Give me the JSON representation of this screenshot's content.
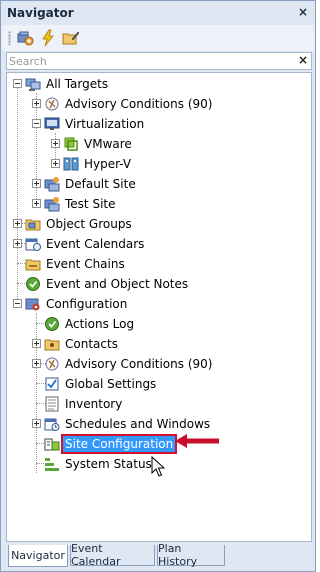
{
  "panel": {
    "title": "Navigator",
    "close_glyph": "×"
  },
  "toolbar": {
    "buttons": [
      {
        "name": "add-target-icon"
      },
      {
        "name": "lightning-icon"
      },
      {
        "name": "folder-edit-icon"
      }
    ]
  },
  "search": {
    "placeholder": "Search",
    "value": "",
    "clear_glyph": "×"
  },
  "tree": {
    "nodes": [
      {
        "label": "All Targets",
        "icon": "all-targets-icon"
      },
      {
        "label": "Advisory Conditions (90)",
        "icon": "advisory-icon"
      },
      {
        "label": "Virtualization",
        "icon": "monitor-icon"
      },
      {
        "label": "VMware",
        "icon": "vmware-icon"
      },
      {
        "label": "Hyper-V",
        "icon": "hyperv-icon"
      },
      {
        "label": "Default Site",
        "icon": "site-icon"
      },
      {
        "label": "Test Site",
        "icon": "site-icon"
      },
      {
        "label": "Object Groups",
        "icon": "object-groups-icon"
      },
      {
        "label": "Event Calendars",
        "icon": "calendar-icon"
      },
      {
        "label": "Event Chains",
        "icon": "event-chains-icon"
      },
      {
        "label": "Event and Object Notes",
        "icon": "notes-icon"
      },
      {
        "label": "Configuration",
        "icon": "configuration-icon"
      },
      {
        "label": "Actions Log",
        "icon": "actions-log-icon"
      },
      {
        "label": "Contacts",
        "icon": "contacts-icon"
      },
      {
        "label": "Advisory Conditions (90)",
        "icon": "advisory-icon"
      },
      {
        "label": "Global Settings",
        "icon": "global-settings-icon"
      },
      {
        "label": "Inventory",
        "icon": "inventory-icon"
      },
      {
        "label": "Schedules and Windows",
        "icon": "schedules-icon"
      },
      {
        "label": "Site Configuration",
        "icon": "site-configuration-icon"
      },
      {
        "label": "System Status",
        "icon": "system-status-icon"
      }
    ]
  },
  "tabs": [
    {
      "label": "Navigator",
      "active": true
    },
    {
      "label": "Event Calendar",
      "active": false
    },
    {
      "label": "Plan History",
      "active": false
    }
  ],
  "colors": {
    "selection": "#3399ff",
    "highlight_border": "#d1112b",
    "arrow": "#c8102e"
  }
}
